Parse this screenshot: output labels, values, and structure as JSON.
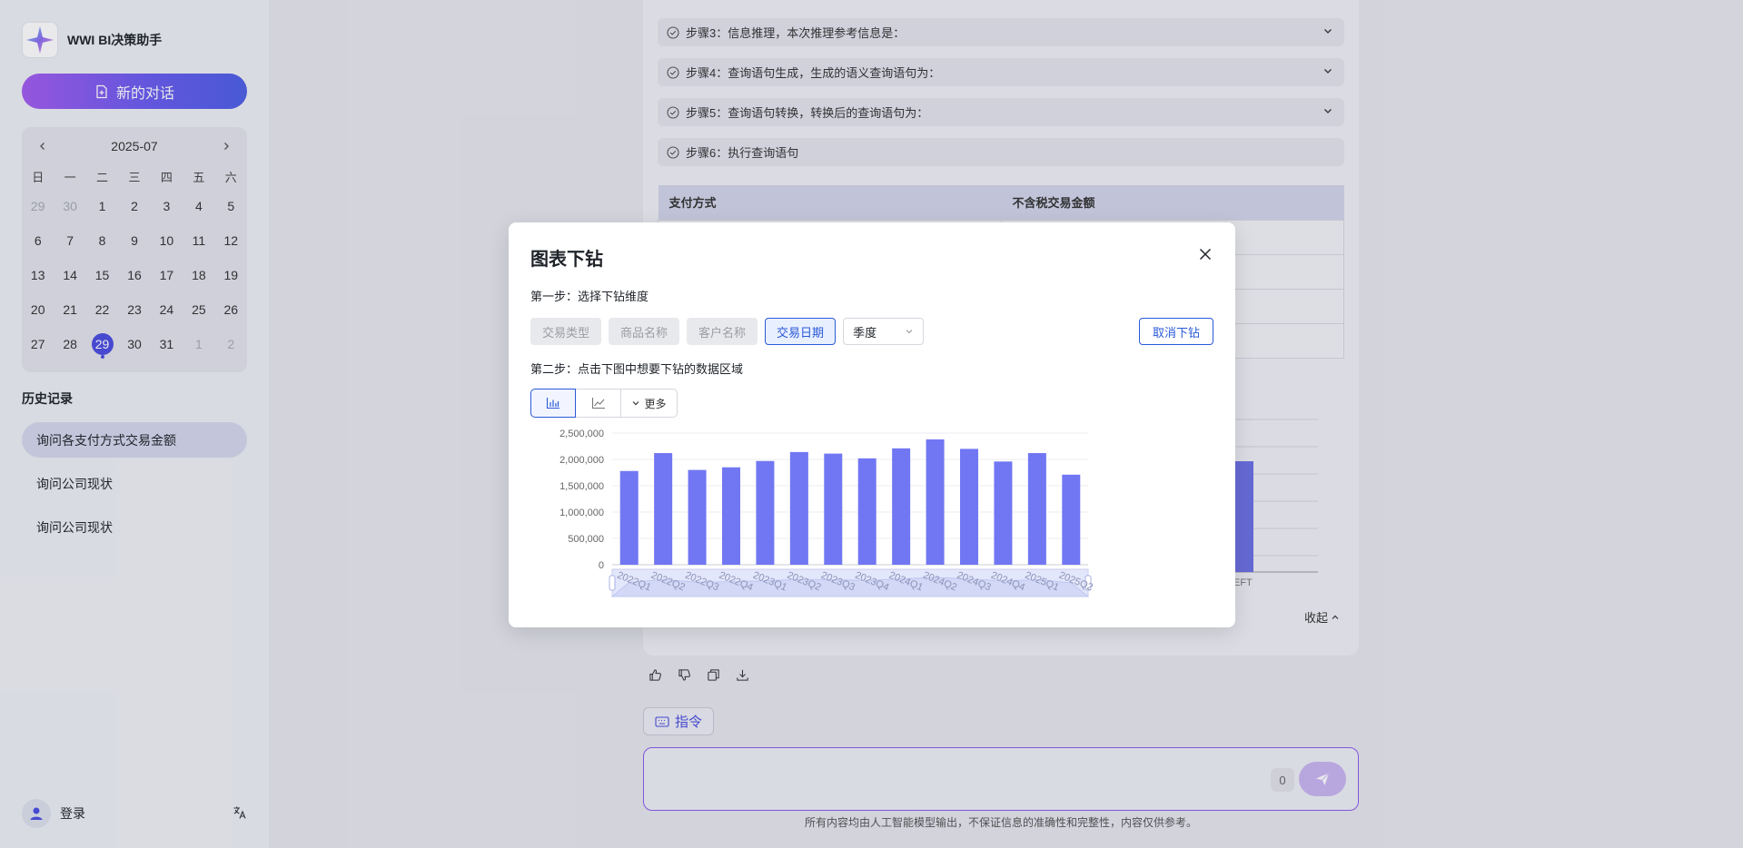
{
  "app": {
    "name": "WWI BI决策助手"
  },
  "sidebar": {
    "new_chat_label": "新的对话",
    "calendar": {
      "month": "2025-07",
      "weekdays": [
        "日",
        "一",
        "二",
        "三",
        "四",
        "五",
        "六"
      ],
      "days": [
        "29",
        "30",
        "1",
        "2",
        "3",
        "4",
        "5",
        "6",
        "7",
        "8",
        "9",
        "10",
        "11",
        "12",
        "13",
        "14",
        "15",
        "16",
        "17",
        "18",
        "19",
        "20",
        "21",
        "22",
        "23",
        "24",
        "25",
        "26",
        "27",
        "28",
        "29",
        "30",
        "31",
        "1",
        "2"
      ],
      "selected": "29"
    },
    "history_title": "历史记录",
    "history": [
      "询问各支付方式交易金额",
      "询问公司现状",
      "询问公司现状"
    ],
    "login_label": "登录"
  },
  "main": {
    "steps": [
      "步骤3：信息推理，本次推理参考信息是：",
      "步骤4：查询语句生成，生成的语义查询语句为：",
      "步骤5：查询语句转换，转换后的查询语句为：",
      "步骤6：执行查询语句"
    ],
    "table_headers": [
      "支付方式",
      "不含税交易金额"
    ],
    "bg_chart_label": "EFT",
    "collapse_label": "收起",
    "command_label": "指令",
    "input_placeholder": "",
    "counter": "0",
    "disclaimer": "所有内容均由人工智能模型输出，不保证信息的准确性和完整性，内容仅供参考。"
  },
  "modal": {
    "title": "图表下钻",
    "step1": "第一步：选择下钻维度",
    "dimensions": [
      "交易类型",
      "商品名称",
      "客户名称",
      "交易日期"
    ],
    "active_dimension": "交易日期",
    "granularity": "季度",
    "cancel_label": "取消下钻",
    "step2": "第二步：点击下图中想要下钻的数据区域",
    "more_label": "更多"
  },
  "colors": {
    "accent": "#4b4fe0",
    "bar": "#7177f2",
    "primary_blue": "#2a59d8"
  },
  "chart_data": {
    "type": "bar",
    "categories": [
      "2022Q1",
      "2022Q2",
      "2022Q3",
      "2022Q4",
      "2023Q1",
      "2023Q2",
      "2023Q3",
      "2023Q4",
      "2024Q1",
      "2024Q2",
      "2024Q3",
      "2024Q4",
      "2025Q1",
      "2025Q2"
    ],
    "values": [
      1780000,
      2120000,
      1800000,
      1850000,
      1970000,
      2140000,
      2110000,
      2020000,
      2210000,
      2380000,
      2200000,
      1960000,
      2120000,
      1710000
    ],
    "yticks": [
      "0",
      "500,000",
      "1,000,000",
      "1,500,000",
      "2,000,000",
      "2,500,000"
    ],
    "ylim": [
      0,
      2500000
    ],
    "title": "",
    "xlabel": "",
    "ylabel": ""
  }
}
